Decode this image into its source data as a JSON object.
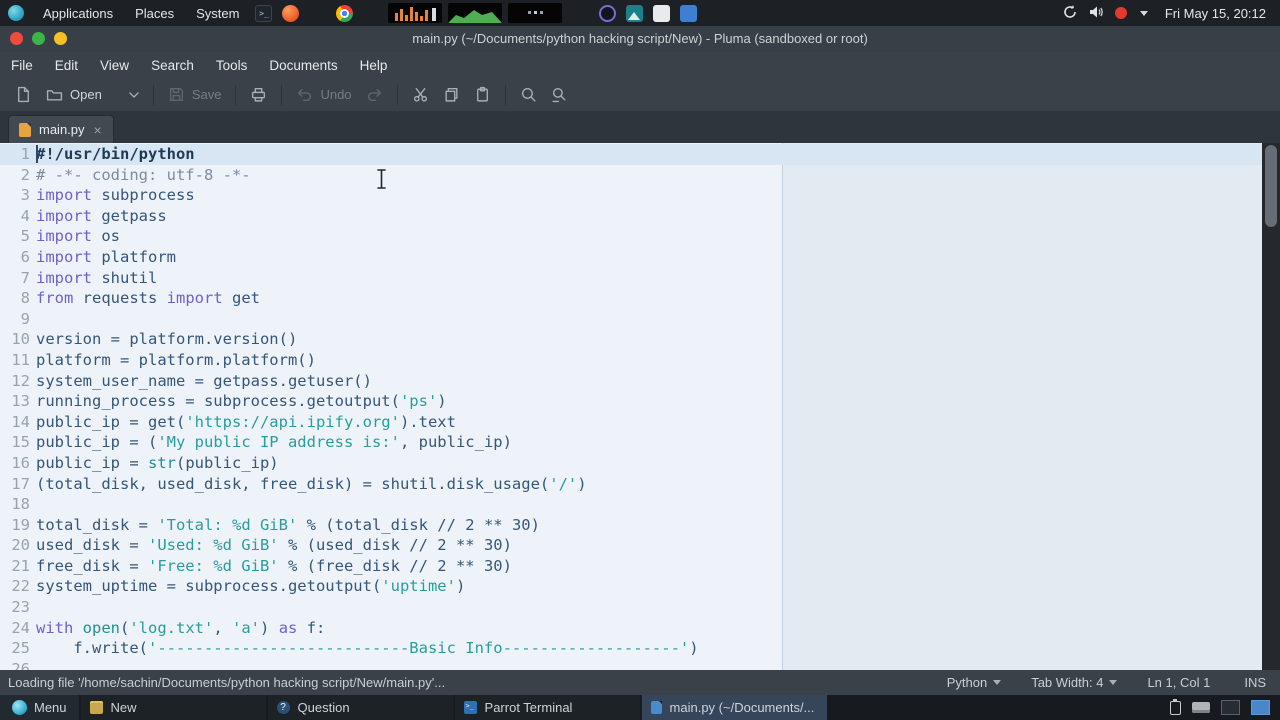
{
  "top_panel": {
    "menus": [
      "Applications",
      "Places",
      "System"
    ],
    "clock": "Fri May 15, 20:12"
  },
  "window": {
    "title": "main.py (~/Documents/python hacking script/New) - Pluma (sandboxed or root)"
  },
  "menubar": {
    "items": [
      "File",
      "Edit",
      "View",
      "Search",
      "Tools",
      "Documents",
      "Help"
    ]
  },
  "toolbar": {
    "open": "Open",
    "save": "Save",
    "undo": "Undo"
  },
  "tab": {
    "label": "main.py",
    "close": "×"
  },
  "editor": {
    "lines": [
      [
        [
          "sh",
          "#!/usr/bin/python"
        ]
      ],
      [
        [
          "c",
          "# -*- coding: utf-8 -*-"
        ]
      ],
      [
        [
          "k",
          "import"
        ],
        [
          "d",
          " subprocess"
        ]
      ],
      [
        [
          "k",
          "import"
        ],
        [
          "d",
          " getpass"
        ]
      ],
      [
        [
          "k",
          "import"
        ],
        [
          "d",
          " os"
        ]
      ],
      [
        [
          "k",
          "import"
        ],
        [
          "d",
          " platform"
        ]
      ],
      [
        [
          "k",
          "import"
        ],
        [
          "d",
          " shutil"
        ]
      ],
      [
        [
          "k",
          "from"
        ],
        [
          "d",
          " requests "
        ],
        [
          "k",
          "import"
        ],
        [
          "d",
          " get"
        ]
      ],
      [],
      [
        [
          "d",
          "version = platform.version()"
        ]
      ],
      [
        [
          "d",
          "platform = platform.platform()"
        ]
      ],
      [
        [
          "d",
          "system_user_name = getpass.getuser()"
        ]
      ],
      [
        [
          "d",
          "running_process = subprocess.getoutput("
        ],
        [
          "s",
          "'ps'"
        ],
        [
          "d",
          ")"
        ]
      ],
      [
        [
          "d",
          "public_ip = get("
        ],
        [
          "s",
          "'https://api.ipify.org'"
        ],
        [
          "d",
          ").text"
        ]
      ],
      [
        [
          "d",
          "public_ip = ("
        ],
        [
          "s",
          "'My public IP address is:'"
        ],
        [
          "d",
          ", public_ip)"
        ]
      ],
      [
        [
          "d",
          "public_ip = "
        ],
        [
          "b",
          "str"
        ],
        [
          "d",
          "(public_ip)"
        ]
      ],
      [
        [
          "d",
          "(total_disk, used_disk, free_disk) = shutil.disk_usage("
        ],
        [
          "s",
          "'/'"
        ],
        [
          "d",
          ")"
        ]
      ],
      [],
      [
        [
          "d",
          "total_disk = "
        ],
        [
          "s",
          "'Total: %d GiB'"
        ],
        [
          "d",
          " % (total_disk // 2 ** 30)"
        ]
      ],
      [
        [
          "d",
          "used_disk = "
        ],
        [
          "s",
          "'Used: %d GiB'"
        ],
        [
          "d",
          " % (used_disk // 2 ** 30)"
        ]
      ],
      [
        [
          "d",
          "free_disk = "
        ],
        [
          "s",
          "'Free: %d GiB'"
        ],
        [
          "d",
          " % (free_disk // 2 ** 30)"
        ]
      ],
      [
        [
          "d",
          "system_uptime = subprocess.getoutput("
        ],
        [
          "s",
          "'uptime'"
        ],
        [
          "d",
          ")"
        ]
      ],
      [],
      [
        [
          "k",
          "with"
        ],
        [
          "d",
          " "
        ],
        [
          "b",
          "open"
        ],
        [
          "d",
          "("
        ],
        [
          "s",
          "'log.txt'"
        ],
        [
          "d",
          ", "
        ],
        [
          "s",
          "'a'"
        ],
        [
          "d",
          ") "
        ],
        [
          "k",
          "as"
        ],
        [
          "d",
          " f:"
        ]
      ],
      [
        [
          "d",
          "    f.write("
        ],
        [
          "s",
          "'---------------------------Basic Info-------------------'"
        ],
        [
          "d",
          ")"
        ]
      ],
      []
    ]
  },
  "statusbar": {
    "message": "Loading file '/home/sachin/Documents/python hacking script/New/main.py'...",
    "language": "Python",
    "tab_width": "Tab Width: 4",
    "position": "Ln 1, Col 1",
    "mode": "INS"
  },
  "taskbar": {
    "menu": "Menu",
    "items": [
      {
        "icon": "folder",
        "label": "New",
        "active": false
      },
      {
        "icon": "question",
        "label": "Question",
        "active": false
      },
      {
        "icon": "terminal",
        "label": "Parrot Terminal",
        "active": false
      },
      {
        "icon": "file",
        "label": "main.py (~/Documents/...",
        "active": true
      }
    ]
  },
  "colors": {
    "accent": "#4b86c8",
    "editor_bg": "#eef3f9",
    "chrome_bg": "#3a4148"
  }
}
